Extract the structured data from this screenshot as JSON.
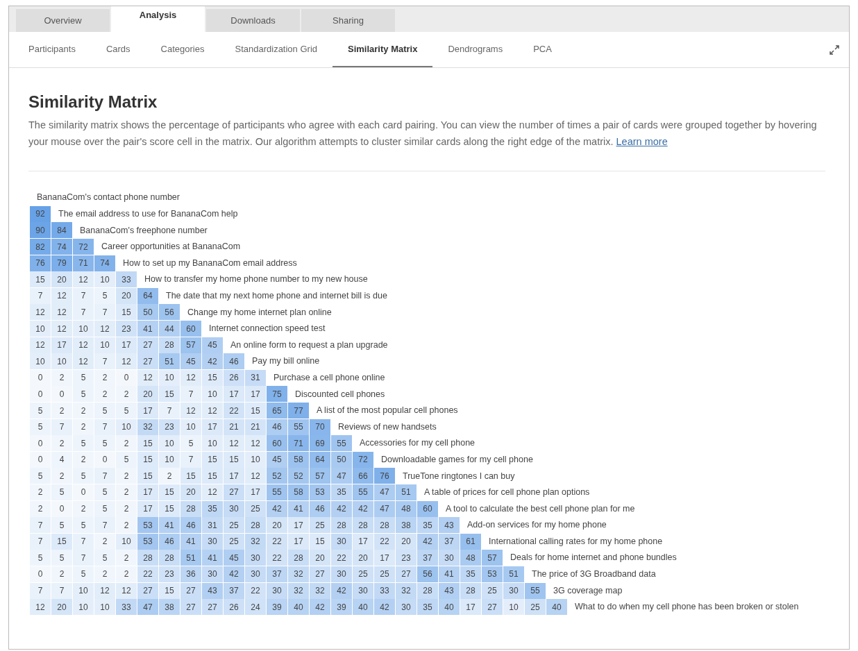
{
  "tabs": [
    {
      "label": "Overview",
      "selected": false
    },
    {
      "label": "Analysis",
      "selected": true
    },
    {
      "label": "Downloads",
      "selected": false
    },
    {
      "label": "Sharing",
      "selected": false
    }
  ],
  "subtabs": [
    {
      "label": "Participants",
      "selected": false
    },
    {
      "label": "Cards",
      "selected": false
    },
    {
      "label": "Categories",
      "selected": false
    },
    {
      "label": "Standardization Grid",
      "selected": false
    },
    {
      "label": "Similarity Matrix",
      "selected": true
    },
    {
      "label": "Dendrograms",
      "selected": false
    },
    {
      "label": "PCA",
      "selected": false
    }
  ],
  "heading": "Similarity Matrix",
  "description": "The similarity matrix shows the percentage of participants who agree with each card pairing. You can view the number of times a pair of cards were grouped together by hovering your mouse over the pair's score cell in the matrix. Our algorithm attempts to cluster similar cards along the right edge of the matrix.",
  "learn_more_link": "Learn more",
  "matrix_rows": [
    {
      "label": "BananaCom's contact phone number"
    },
    {
      "label": "The email address to use for BananaCom help",
      "values": [
        "92"
      ]
    },
    {
      "label": "BananaCom's freephone number",
      "values": [
        "90",
        "84"
      ]
    },
    {
      "label": "Career opportunities at BananaCom",
      "values": [
        "82",
        "74",
        "72"
      ]
    },
    {
      "label": "How to set up my BananaCom email address",
      "values": [
        "76",
        "79",
        "71",
        "74"
      ]
    },
    {
      "label": "How to transfer my home phone number to my new house",
      "values": [
        "15",
        "20",
        "12",
        "10",
        "33"
      ]
    },
    {
      "label": "The date that my next home phone and internet bill is due",
      "values": [
        "7",
        "12",
        "7",
        "5",
        "20",
        "64"
      ]
    },
    {
      "label": "Change my home internet plan online",
      "values": [
        "12",
        "12",
        "7",
        "7",
        "15",
        "50",
        "56"
      ]
    },
    {
      "label": "Internet connection speed test",
      "values": [
        "10",
        "12",
        "10",
        "12",
        "23",
        "41",
        "44",
        "60"
      ]
    },
    {
      "label": "An online form to request a plan upgrade",
      "values": [
        "12",
        "17",
        "12",
        "10",
        "17",
        "27",
        "28",
        "57",
        "45"
      ]
    },
    {
      "label": "Pay my bill online",
      "values": [
        "10",
        "10",
        "12",
        "7",
        "12",
        "27",
        "51",
        "45",
        "42",
        "46"
      ]
    },
    {
      "label": "Purchase a cell phone online",
      "values": [
        "0",
        "2",
        "5",
        "2",
        "0",
        "12",
        "10",
        "12",
        "15",
        "26",
        "31"
      ]
    },
    {
      "label": "Discounted cell phones",
      "values": [
        "0",
        "0",
        "5",
        "2",
        "2",
        "20",
        "15",
        "7",
        "10",
        "17",
        "17",
        "75"
      ]
    },
    {
      "label": "A list of the most popular cell phones",
      "values": [
        "5",
        "2",
        "2",
        "5",
        "5",
        "17",
        "7",
        "12",
        "12",
        "22",
        "15",
        "65",
        "77"
      ]
    },
    {
      "label": "Reviews of new handsets",
      "values": [
        "5",
        "7",
        "2",
        "7",
        "10",
        "32",
        "23",
        "10",
        "17",
        "21",
        "21",
        "46",
        "55",
        "70"
      ]
    },
    {
      "label": "Accessories for my cell phone",
      "values": [
        "0",
        "2",
        "5",
        "5",
        "2",
        "15",
        "10",
        "5",
        "10",
        "12",
        "12",
        "60",
        "71",
        "69",
        "55"
      ]
    },
    {
      "label": "Downloadable games for my cell phone",
      "values": [
        "0",
        "4",
        "2",
        "0",
        "5",
        "15",
        "10",
        "7",
        "15",
        "15",
        "10",
        "45",
        "58",
        "64",
        "50",
        "72"
      ]
    },
    {
      "label": "TrueTone ringtones I can buy",
      "values": [
        "5",
        "2",
        "5",
        "7",
        "2",
        "15",
        "2",
        "15",
        "15",
        "17",
        "12",
        "52",
        "52",
        "57",
        "47",
        "66",
        "76"
      ]
    },
    {
      "label": "A table of prices for cell phone plan options",
      "values": [
        "2",
        "5",
        "0",
        "5",
        "2",
        "17",
        "15",
        "20",
        "12",
        "27",
        "17",
        "55",
        "58",
        "53",
        "35",
        "55",
        "47",
        "51"
      ]
    },
    {
      "label": "A tool to calculate the best cell phone plan for me",
      "values": [
        "2",
        "0",
        "2",
        "5",
        "2",
        "17",
        "15",
        "28",
        "35",
        "30",
        "25",
        "42",
        "41",
        "46",
        "42",
        "42",
        "47",
        "48",
        "60"
      ]
    },
    {
      "label": "Add-on services for my home phone",
      "values": [
        "7",
        "5",
        "5",
        "7",
        "2",
        "53",
        "41",
        "46",
        "31",
        "25",
        "28",
        "20",
        "17",
        "25",
        "28",
        "28",
        "28",
        "38",
        "35",
        "43"
      ]
    },
    {
      "label": "International calling rates for my home phone",
      "values": [
        "7",
        "15",
        "7",
        "2",
        "10",
        "53",
        "46",
        "41",
        "30",
        "25",
        "32",
        "22",
        "17",
        "15",
        "30",
        "17",
        "22",
        "20",
        "42",
        "37",
        "61"
      ]
    },
    {
      "label": "Deals for home internet and phone bundles",
      "values": [
        "5",
        "5",
        "7",
        "5",
        "2",
        "28",
        "28",
        "51",
        "41",
        "45",
        "30",
        "22",
        "28",
        "20",
        "22",
        "20",
        "17",
        "23",
        "37",
        "30",
        "48",
        "57"
      ]
    },
    {
      "label": "The price of 3G Broadband data",
      "values": [
        "0",
        "2",
        "5",
        "2",
        "2",
        "22",
        "23",
        "36",
        "30",
        "42",
        "30",
        "37",
        "32",
        "27",
        "30",
        "25",
        "25",
        "27",
        "56",
        "41",
        "35",
        "53",
        "51"
      ]
    },
    {
      "label": "3G coverage map",
      "values": [
        "7",
        "7",
        "10",
        "12",
        "12",
        "27",
        "15",
        "27",
        "43",
        "37",
        "22",
        "30",
        "32",
        "32",
        "42",
        "30",
        "33",
        "32",
        "28",
        "43",
        "28",
        "25",
        "30",
        "55"
      ]
    },
    {
      "label": "What to do when my cell phone has been broken or stolen",
      "values": [
        "12",
        "20",
        "10",
        "10",
        "33",
        "47",
        "38",
        "27",
        "27",
        "26",
        "24",
        "39",
        "40",
        "42",
        "39",
        "40",
        "42",
        "30",
        "35",
        "40",
        "17",
        "27",
        "10",
        "25",
        "40"
      ]
    }
  ]
}
